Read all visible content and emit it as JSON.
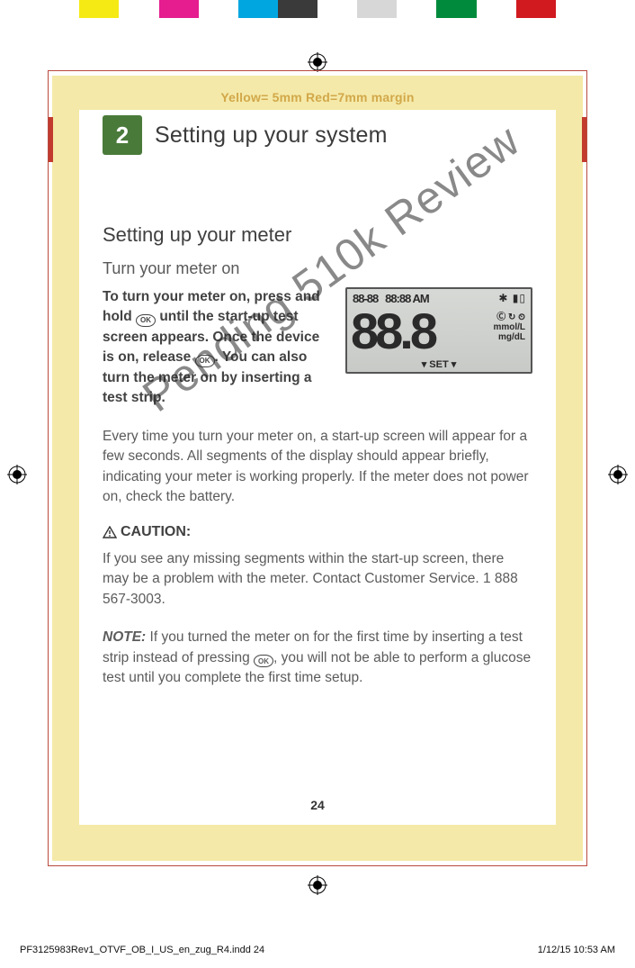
{
  "colorbar": [
    "#ffffff",
    "#ffffff",
    "#f5ea14",
    "#ffffff",
    "#e51d8e",
    "#ffffff",
    "#00a6e0",
    "#3a3a3a",
    "#ffffff",
    "#d7d7d7",
    "#ffffff",
    "#008a3c",
    "#ffffff",
    "#d11920",
    "#ffffff",
    "#ffffff"
  ],
  "margin_label": "Yellow= 5mm  Red=7mm margin",
  "chapter": {
    "num": "2",
    "title": "Setting up your system"
  },
  "section_title": "Setting up your meter",
  "subhead": "Turn your meter on",
  "instr_parts": {
    "a": "To turn your meter on, press and hold ",
    "b": " until the start-up test screen appears. Once the device is on, release ",
    "c": ". You can also turn the meter on by inserting a test strip."
  },
  "ok_label": "OK",
  "lcd": {
    "date": "88-88",
    "time": "88:88 AM",
    "icons_right": "✱ ▮▯",
    "big": "88.8",
    "side1": "Ⓒ ↻ ⏲",
    "side2": "mmol/L",
    "side3": "mg/dL",
    "set": "▾  SET  ▾"
  },
  "para1": "Every time you turn your meter on, a start-up screen will appear for a few seconds. All segments of the display should appear briefly, indicating your meter is working properly. If the meter does not power on, check the battery.",
  "caution_label": "CAUTION:",
  "para2": "If you see any missing segments within the start-up screen, there may be a problem with the meter. Contact Customer Service. 1 888 567-3003.",
  "note_label": "NOTE:",
  "para3_a": " If you turned the meter on for the first time by inserting a test strip instead of pressing ",
  "para3_b": ", you will not be able to perform a glucose test until you complete the first time setup.",
  "pagenum": "24",
  "watermark": "Pending 510k Review",
  "footer": {
    "left": "PF3125983Rev1_OTVF_OB_I_US_en_zug_R4.indd   24",
    "right": "1/12/15   10:53 AM"
  }
}
